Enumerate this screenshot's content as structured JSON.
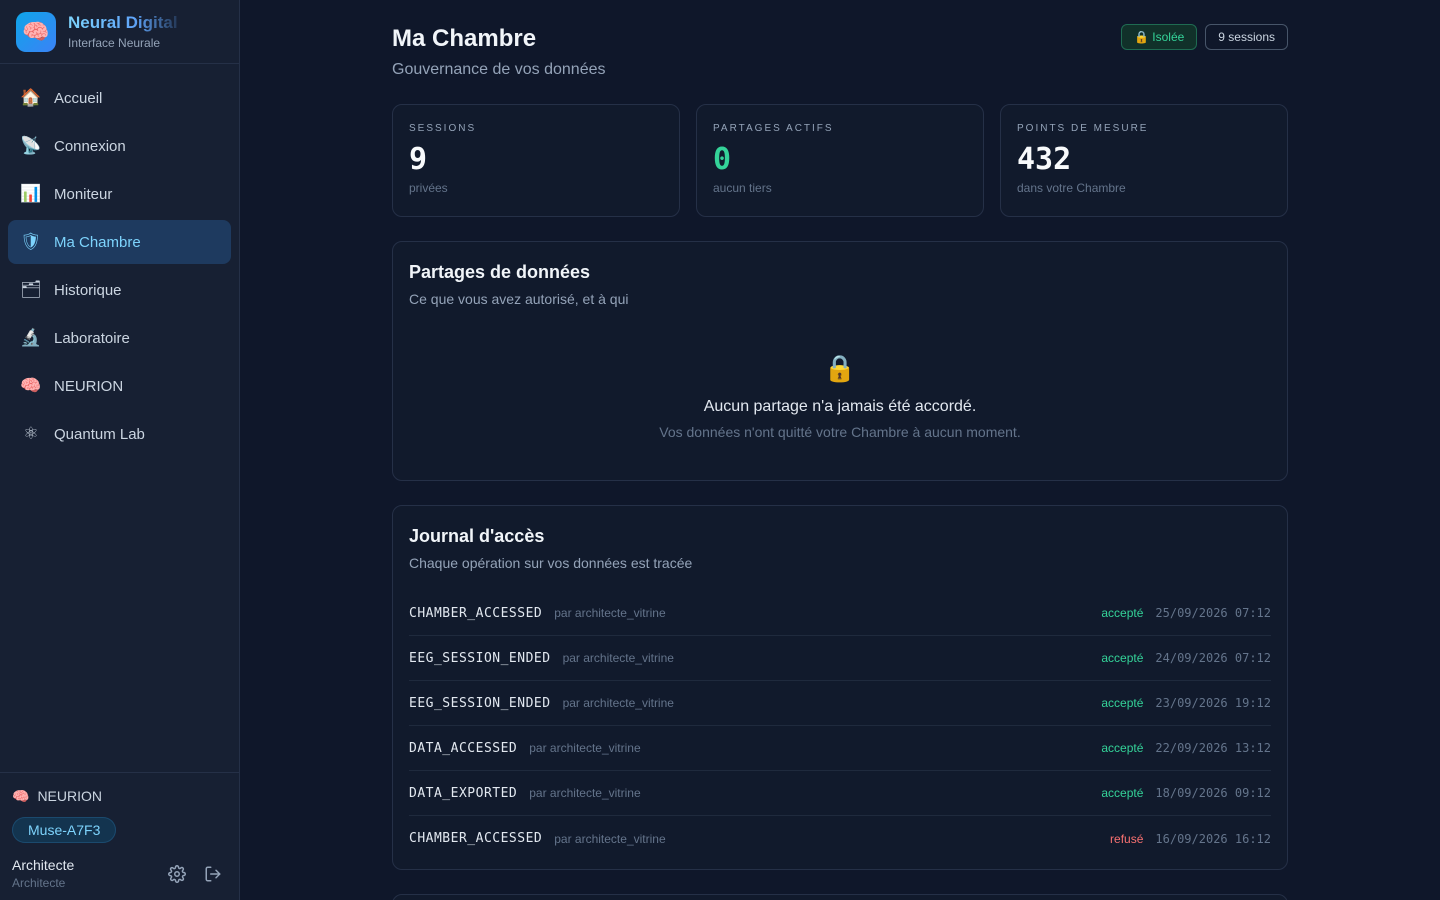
{
  "brand": {
    "name": "Neural Digital",
    "subtitle": "Interface Neurale",
    "logo_icon": "brain-icon"
  },
  "nav": [
    {
      "label": "Accueil",
      "icon": "🏠",
      "icon_name": "house-icon",
      "active": false
    },
    {
      "label": "Connexion",
      "icon": "📡",
      "icon_name": "satellite-dish-icon",
      "active": false
    },
    {
      "label": "Moniteur",
      "icon": "📊",
      "icon_name": "bar-chart-icon",
      "active": false
    },
    {
      "label": "Ma Chambre",
      "icon": "🛡",
      "icon_name": "shield-icon",
      "active": true
    },
    {
      "label": "Historique",
      "icon": "🗂",
      "icon_name": "folder-icon",
      "active": false
    },
    {
      "label": "Laboratoire",
      "icon": "🔬",
      "icon_name": "microscope-icon",
      "active": false
    },
    {
      "label": "NEURION",
      "icon": "🧠",
      "icon_name": "brain-icon",
      "active": false
    },
    {
      "label": "Quantum Lab",
      "icon": "⚛",
      "icon_name": "atom-icon",
      "active": false
    }
  ],
  "footer": {
    "device_label": "NEURION",
    "device_chip": "Muse-A7F3",
    "user_name": "Architecte",
    "user_role": "Architecte"
  },
  "header": {
    "title": "Ma Chambre",
    "subtitle": "Gouvernance de vos données",
    "badge_isolated": "🔒 Isolée",
    "badge_sessions": "9 sessions"
  },
  "stats": [
    {
      "label": "SESSIONS",
      "value": "9",
      "sub": "privées",
      "accent": false
    },
    {
      "label": "PARTAGES ACTIFS",
      "value": "0",
      "sub": "aucun tiers",
      "accent": true
    },
    {
      "label": "POINTS DE MESURE",
      "value": "432",
      "sub": "dans votre Chambre",
      "accent": false
    }
  ],
  "shares": {
    "title": "Partages de données",
    "subtitle": "Ce que vous avez autorisé, et à qui",
    "empty_icon": "🔒",
    "empty_title": "Aucun partage n'a jamais été accordé.",
    "empty_sub": "Vos données n'ont quitté votre Chambre à aucun moment."
  },
  "journal": {
    "title": "Journal d'accès",
    "subtitle": "Chaque opération sur vos données est tracée",
    "rows": [
      {
        "event": "CHAMBER_ACCESSED",
        "by": "par architecte_vitrine",
        "status": "accepté",
        "ok": true,
        "time": "25/09/2026 07:12"
      },
      {
        "event": "EEG_SESSION_ENDED",
        "by": "par architecte_vitrine",
        "status": "accepté",
        "ok": true,
        "time": "24/09/2026 07:12"
      },
      {
        "event": "EEG_SESSION_ENDED",
        "by": "par architecte_vitrine",
        "status": "accepté",
        "ok": true,
        "time": "23/09/2026 19:12"
      },
      {
        "event": "DATA_ACCESSED",
        "by": "par architecte_vitrine",
        "status": "accepté",
        "ok": true,
        "time": "22/09/2026 13:12"
      },
      {
        "event": "DATA_EXPORTED",
        "by": "par architecte_vitrine",
        "status": "accepté",
        "ok": true,
        "time": "18/09/2026 09:12"
      },
      {
        "event": "CHAMBER_ACCESSED",
        "by": "par architecte_vitrine",
        "status": "refusé",
        "ok": false,
        "time": "16/09/2026 16:12"
      }
    ]
  },
  "colors": {
    "accent": "#7dd3fc",
    "success": "#34d399",
    "danger": "#f87171",
    "background": "#0f172a"
  }
}
